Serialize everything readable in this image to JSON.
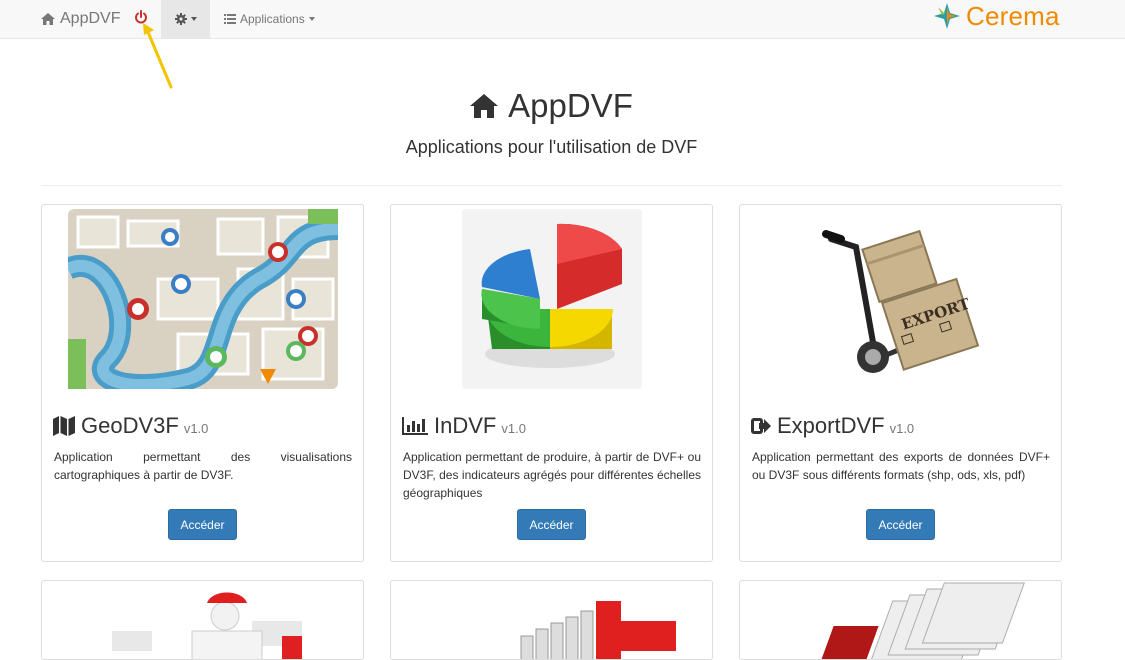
{
  "navbar": {
    "brand": "AppDVF",
    "applications_label": "Applications",
    "logo_text": "Cerema",
    "colors": {
      "power": "#c9302c",
      "logo": "#f08a00",
      "arrow": "#f2c500"
    }
  },
  "header": {
    "title": "AppDVF",
    "subtitle": "Applications pour l'utilisation de DVF"
  },
  "cards": [
    {
      "title": "GeoDV3F",
      "version": "v1.0",
      "icon": "map-icon",
      "description": "Application permettant des visualisations cartographiques à partir de DV3F.",
      "button": "Accéder"
    },
    {
      "title": "InDVF",
      "version": "v1.0",
      "icon": "bar-chart-icon",
      "description": "Application permettant de produire, à partir de DVF+ ou DV3F, des indicateurs agrégés pour différentes échelles géographiques",
      "button": "Accéder"
    },
    {
      "title": "ExportDVF",
      "version": "v1.0",
      "icon": "export-icon",
      "description": "Application permettant des exports de données DVF+ ou DV3F sous différents formats (shp, ods, xls, pdf)",
      "button": "Accéder"
    }
  ],
  "export_image_text": "EXPORT",
  "accent_button_color": "#337ab7"
}
